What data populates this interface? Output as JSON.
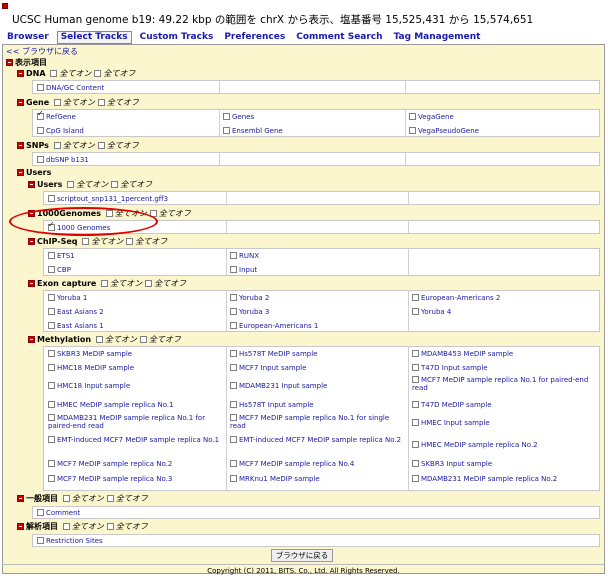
{
  "header": {
    "title": "UCSC Human genome b19: 49.22 kbp の範囲を chrX から表示、塩基番号 15,525,431 から 15,574,651"
  },
  "tabs": [
    {
      "label": "Browser",
      "active": false
    },
    {
      "label": "Select Tracks",
      "active": true
    },
    {
      "label": "Custom Tracks",
      "active": false
    },
    {
      "label": "Preferences",
      "active": false
    },
    {
      "label": "Comment Search",
      "active": false
    },
    {
      "label": "Tag Management",
      "active": false
    }
  ],
  "back_link": "<< ブラウザに戻る",
  "section_title": "表示項目",
  "all_on": "全てオン",
  "all_off": "全てオフ",
  "groups": {
    "dna": {
      "label": "DNA",
      "items": [
        "DNA/GC Content"
      ]
    },
    "gene": {
      "label": "Gene",
      "items": [
        "RefGene",
        "Genes",
        "VegaGene",
        "CpG Island",
        "Ensembl Gene",
        "VegaPseudoGene"
      ]
    },
    "snps": {
      "label": "SNPs",
      "items": [
        "dbSNP b131"
      ]
    },
    "users": {
      "label": "Users"
    },
    "users_sub": {
      "label": "Users",
      "items": [
        "scriptout_snp131_1percent.gff3"
      ]
    },
    "genomes_1000": {
      "label": "1000Genomes",
      "items": [
        "1000 Genomes"
      ]
    },
    "chip_seq": {
      "label": "ChIP-Seq",
      "items": [
        "ETS1",
        "RUNX",
        "CBP",
        "Input"
      ]
    },
    "exon_capture": {
      "label": "Exon capture",
      "items": [
        "Yoruba 1",
        "Yoruba 2",
        "European-Americans 2",
        "East Asians 2",
        "Yoruba 3",
        "Yoruba 4",
        "East Asians 1",
        "European-Americans 1"
      ]
    },
    "methylation": {
      "label": "Methylation",
      "items": [
        "SKBR3 MeDIP sample",
        "Hs578T MeDIP sample",
        "MDAMB453 MeDIP sample",
        "HMC18 MeDIP sample",
        "MCF7 Input sample",
        "T47D Input sample",
        "HMC18 Input sample",
        "MDAMB231 Input sample",
        "MCF7 MeDIP sample replica No.1 for paired-end read",
        "HMEC MeDIP sample replica No.1",
        "Hs578T Input sample",
        "T47D MeDIP sample",
        "MDAMB231 MeDIP sample replica No.1 for paired-end read",
        "MCF7 MeDIP sample replica No.1 for single read",
        "HMEC Input sample",
        "EMT-induced MCF7 MeDIP sample replica No.1",
        "EMT-induced MCF7 MeDIP sample replica No.2",
        "HMEC MeDIP sample replica No.2",
        "MCF7 MeDIP sample replica No.2",
        "MCF7 MeDIP sample replica No.4",
        "SKBR3 Input sample",
        "MCF7 MeDIP sample replica No.3",
        "MRKnu1 MeDIP sample",
        "MDAMB231 MeDIP sample replica No.2"
      ]
    },
    "general": {
      "label": "一般項目",
      "items": [
        "Comment"
      ]
    },
    "analysis": {
      "label": "解析項目",
      "items": [
        "Restriction Sites"
      ]
    }
  },
  "back_button": "ブラウザに戻る",
  "copyright": "Copyright (C) 2011, BITS. Co., Ltd. All Rights Reserved.",
  "colors": {
    "panel_bg": "#fbf6cd",
    "link": "#1a1ab0",
    "minus_icon": "#cc0000",
    "highlight_oval": "#e00000"
  }
}
